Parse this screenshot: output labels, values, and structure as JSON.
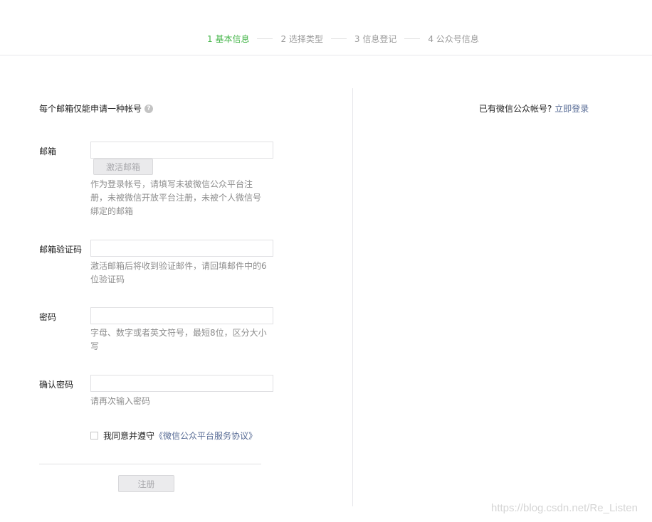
{
  "steps": [
    {
      "label": "1 基本信息"
    },
    {
      "label": "2 选择类型"
    },
    {
      "label": "3 信息登记"
    },
    {
      "label": "4 公众号信息"
    }
  ],
  "colors": {
    "active_step": "#44b549",
    "link": "#576b95",
    "tip": "#8d8d8d"
  },
  "form": {
    "notice": "每个邮箱仅能申请一种帐号",
    "help_icon": "?",
    "email": {
      "label": "邮箱",
      "value": "",
      "activate_button": "激活邮箱",
      "tip": "作为登录帐号，请填写未被微信公众平台注册，未被微信开放平台注册，未被个人微信号绑定的邮箱"
    },
    "code": {
      "label": "邮箱验证码",
      "value": "",
      "tip": "激活邮箱后将收到验证邮件，请回填邮件中的6位验证码"
    },
    "password": {
      "label": "密码",
      "value": "",
      "tip": "字母、数字或者英文符号，最短8位，区分大小写"
    },
    "confirm": {
      "label": "确认密码",
      "value": "",
      "tip": "请再次输入密码"
    },
    "agree": {
      "text": "我同意并遵守",
      "link": "《微信公众平台服务协议》"
    },
    "register_button": "注册"
  },
  "sidebar": {
    "has_account": "已有微信公众帐号?",
    "login_link": "立即登录"
  },
  "watermark": "https://blog.csdn.net/Re_Listen"
}
